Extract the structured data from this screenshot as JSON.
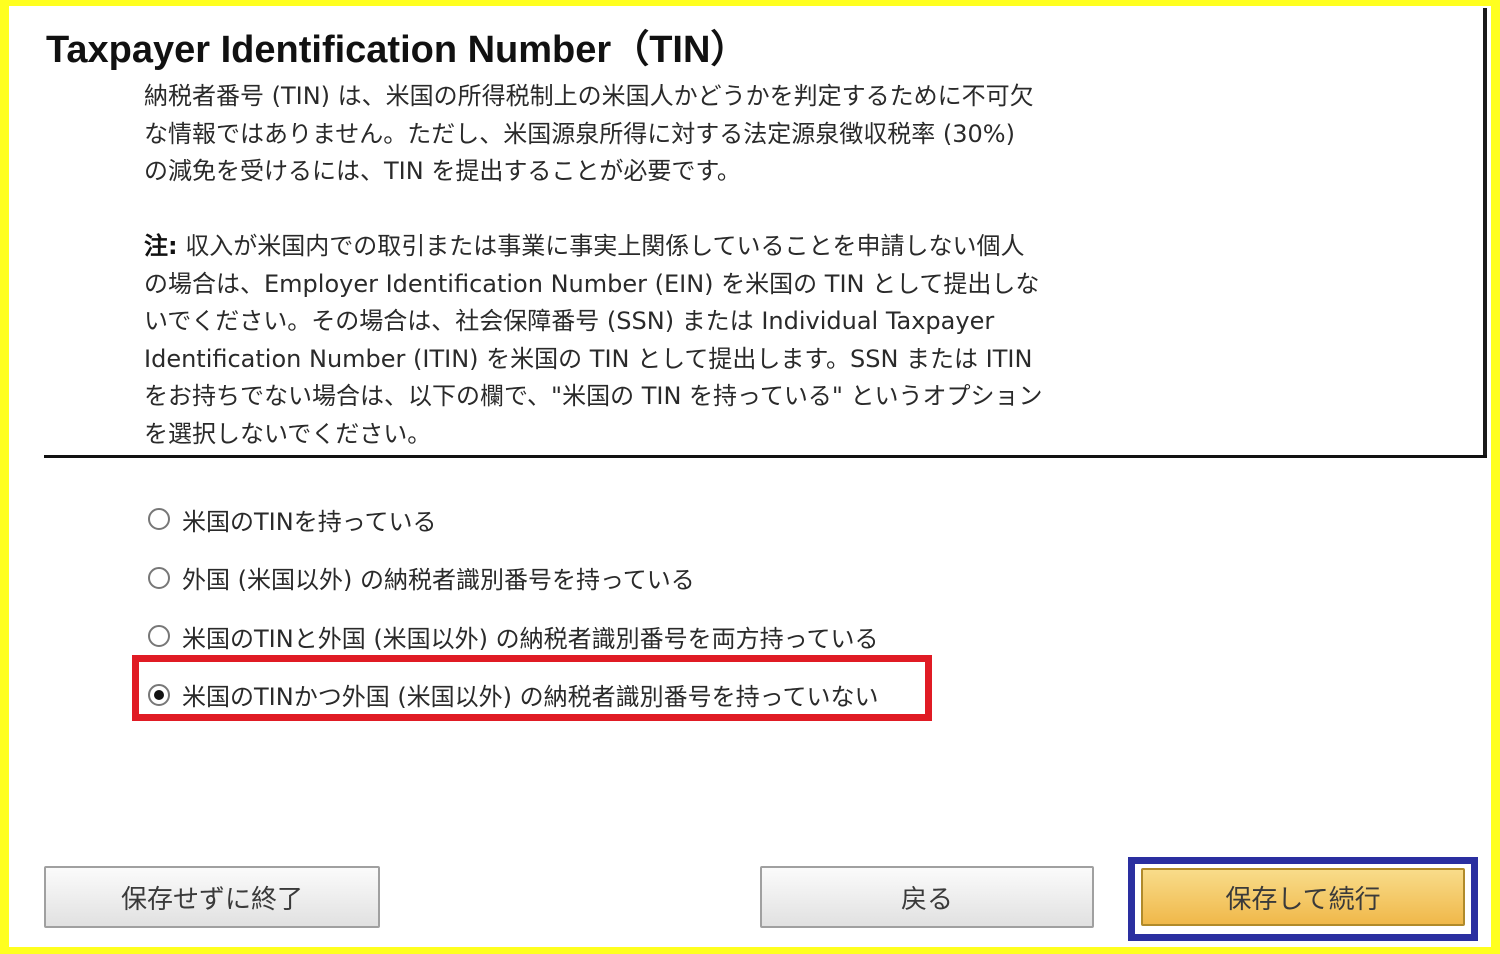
{
  "page": {
    "title": "Taxpayer Identification Number（TIN）"
  },
  "intro": {
    "text": "納税者番号 (TIN) は、米国の所得税制上の米国人かどうかを判定するために不可欠な情報ではありません。ただし、米国源泉所得に対する法定源泉徴収税率 (30%) の減免を受けるには、TIN を提出することが必要です。"
  },
  "note": {
    "label": "注:",
    "text": " 収入が米国内での取引または事業に事実上関係していることを申請しない個人の場合は、Employer Identification Number (EIN) を米国の TIN として提出しないでください。その場合は、社会保障番号 (SSN) または Individual Taxpayer Identification Number (ITIN) を米国の TIN として提出します。SSN または ITIN をお持ちでない場合は、以下の欄で、\"米国の TIN を持っている\" というオプションを選択しないでください。"
  },
  "options": [
    {
      "label": "米国のTINを持っている",
      "selected": false
    },
    {
      "label": "外国 (米国以外) の納税者識別番号を持っている",
      "selected": false
    },
    {
      "label": "米国のTINと外国 (米国以外) の納税者識別番号を両方持っている",
      "selected": false
    },
    {
      "label": "米国のTINかつ外国 (米国以外) の納税者識別番号を持っていない",
      "selected": true
    }
  ],
  "buttons": {
    "exit_label": "保存せずに終了",
    "back_label": "戻る",
    "save_label": "保存して続行"
  },
  "colors": {
    "outer_frame": "#ffff1f",
    "selected_option_highlight": "#e01b24",
    "primary_button_highlight": "#2a2fa0",
    "primary_button": "#f0b84a"
  }
}
